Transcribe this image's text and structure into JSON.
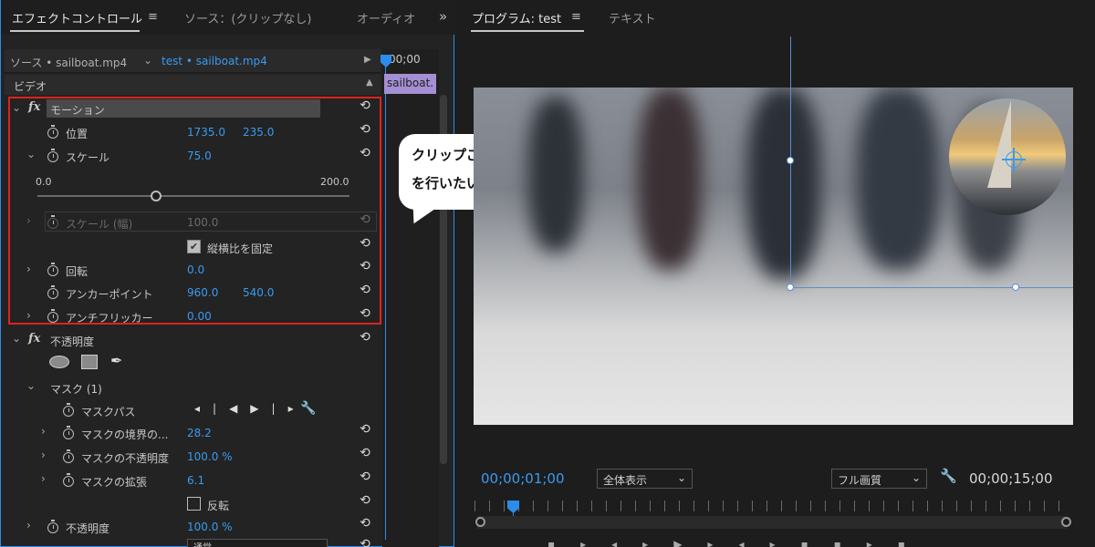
{
  "effect_panel": {
    "tabs": [
      "エフェクトコントロール",
      "ソース：(クリップなし)",
      "オーディオ"
    ],
    "menu_glyph": "≡",
    "overflow_glyph": "»",
    "source_label": "ソース • sailboat.mp4",
    "sequence_label": "test • sailboat.mp4",
    "timecode_start": "00;00",
    "clip_name": "sailboat.",
    "section_video": "ビデオ",
    "motion": {
      "name": "モーション",
      "position_label": "位置",
      "position_x": "1735.0",
      "position_y": "235.0",
      "scale_label": "スケール",
      "scale_value": "75.0",
      "slider_min": "0.0",
      "slider_max": "200.0",
      "slider_fraction": 0.375,
      "scale_width_label": "スケール (幅)",
      "scale_width_value": "100.0",
      "uniform_scale_label": "縦横比を固定",
      "uniform_scale_checked": true,
      "rotation_label": "回転",
      "rotation_value": "0.0",
      "anchor_label": "アンカーポイント",
      "anchor_x": "960.0",
      "anchor_y": "540.0",
      "antiflicker_label": "アンチフリッカー",
      "antiflicker_value": "0.00"
    },
    "opacity_effect": {
      "name": "不透明度",
      "mask_label": "マスク (1)",
      "mask_path_label": "マスクパス",
      "mask_feather_label": "マスクの境界の...",
      "mask_feather_value": "28.2",
      "mask_opacity_label": "マスクの不透明度",
      "mask_opacity_value": "100.0 %",
      "mask_expansion_label": "マスクの拡張",
      "mask_expansion_value": "6.1",
      "inverted_label": "反転",
      "inverted_checked": false,
      "opacity_label": "不透明度",
      "opacity_value": "100.0 %",
      "blend_mode_value": "通常"
    }
  },
  "callout": {
    "line1": "クリップごと移動・拡大縮小・回転",
    "line2": "を行いたいときはモーションを使う"
  },
  "program_monitor": {
    "tabs": [
      "プログラム: test",
      "テキスト"
    ],
    "menu_glyph": "≡",
    "timecode_current": "00;00;01;00",
    "fit_label": "全体表示",
    "quality_label": "フル画質",
    "timecode_duration": "00;00;15;00",
    "playhead_fraction": 0.066
  },
  "colors": {
    "accent_blue": "#2d8ceb",
    "value_blue": "#3a9af0",
    "highlight_red": "#e02020",
    "clip_purple": "#a48fd4"
  },
  "icons": [
    "stopwatch-icon",
    "reset-icon",
    "fx-icon",
    "ellipse-mask-icon",
    "rectangle-mask-icon",
    "pen-mask-icon",
    "wrench-icon",
    "play-icon"
  ]
}
